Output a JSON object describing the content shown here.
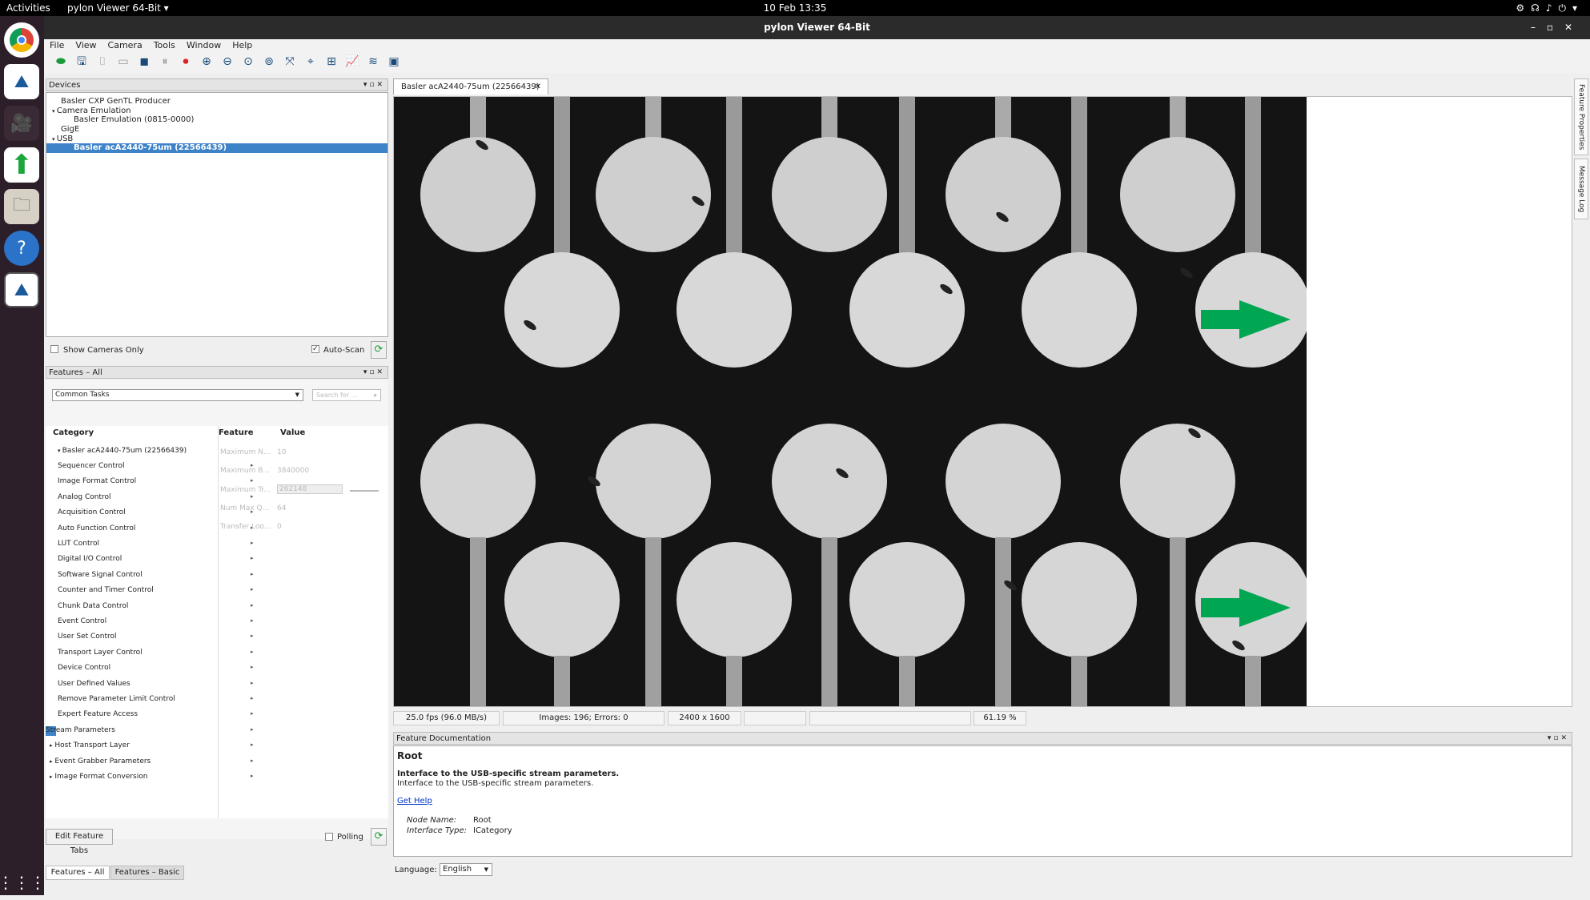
{
  "topbar": {
    "activities": "Activities",
    "app_menu": "pylon Viewer 64-Bit ▾",
    "clock": "10 Feb  13:35"
  },
  "window": {
    "title": "pylon Viewer 64-Bit"
  },
  "menu": [
    "File",
    "View",
    "Camera",
    "Tools",
    "Window",
    "Help"
  ],
  "devices": {
    "title": "Devices",
    "tree": [
      "Basler CXP GenTL Producer",
      "Camera Emulation",
      "Basler Emulation (0815-0000)",
      "GigE",
      "USB",
      "Basler acA2440-75um (22566439)"
    ],
    "show_cameras_only": "Show Cameras Only",
    "auto_scan": "Auto-Scan"
  },
  "features": {
    "title": "Features – All",
    "combo": "Common Tasks",
    "search_placeholder": "Search for ...",
    "col_category": "Category",
    "col_feature": "Feature",
    "col_value": "Value",
    "root": "Basler acA2440-75um (22566439)",
    "categories": [
      "Sequencer Control",
      "Image Format Control",
      "Analog Control",
      "Acquisition Control",
      "Auto Function Control",
      "LUT Control",
      "Digital I/O Control",
      "Software Signal Control",
      "Counter and Timer Control",
      "Chunk Data Control",
      "Event Control",
      "User Set Control",
      "Transport Layer Control",
      "Device Control",
      "User Defined Values",
      "Remove Parameter Limit Control",
      "Expert Feature Access"
    ],
    "stream": "Stream Parameters",
    "others": [
      "Host Transport Layer",
      "Event Grabber Parameters",
      "Image Format Conversion"
    ],
    "rows": [
      {
        "f": "Maximum N...",
        "v": "10"
      },
      {
        "f": "Maximum B...",
        "v": "3840000"
      },
      {
        "f": "Maximum Tr...",
        "v": "262148"
      },
      {
        "f": "Num Max Q...",
        "v": "64"
      },
      {
        "f": "Transfer Loo...",
        "v": "0"
      }
    ],
    "edit_tabs": "Edit Feature Tabs",
    "polling": "Polling",
    "tab_all": "Features – All",
    "tab_basic": "Features – Basic"
  },
  "image_tab": "Basler acA2440-75um (22566439)",
  "status": {
    "fps": "25.0 fps (96.0 MB/s)",
    "images": "Images: 196; Errors: 0",
    "size": "2400 x 1600",
    "zoom": "61.19 %"
  },
  "doc": {
    "title": "Feature Documentation",
    "name": "Root",
    "bold": "Interface to the USB-specific stream parameters.",
    "desc": "Interface to the USB-specific stream parameters.",
    "help": "Get Help",
    "node_label": "Node Name:",
    "node_value": "Root",
    "type_label": "Interface Type:",
    "type_value": "ICategory"
  },
  "language": {
    "label": "Language:",
    "value": "English"
  },
  "side_tabs": [
    "Feature Properties",
    "Message Log"
  ],
  "colors": {
    "accent": "#3d83c8",
    "arrow": "#00a651"
  }
}
